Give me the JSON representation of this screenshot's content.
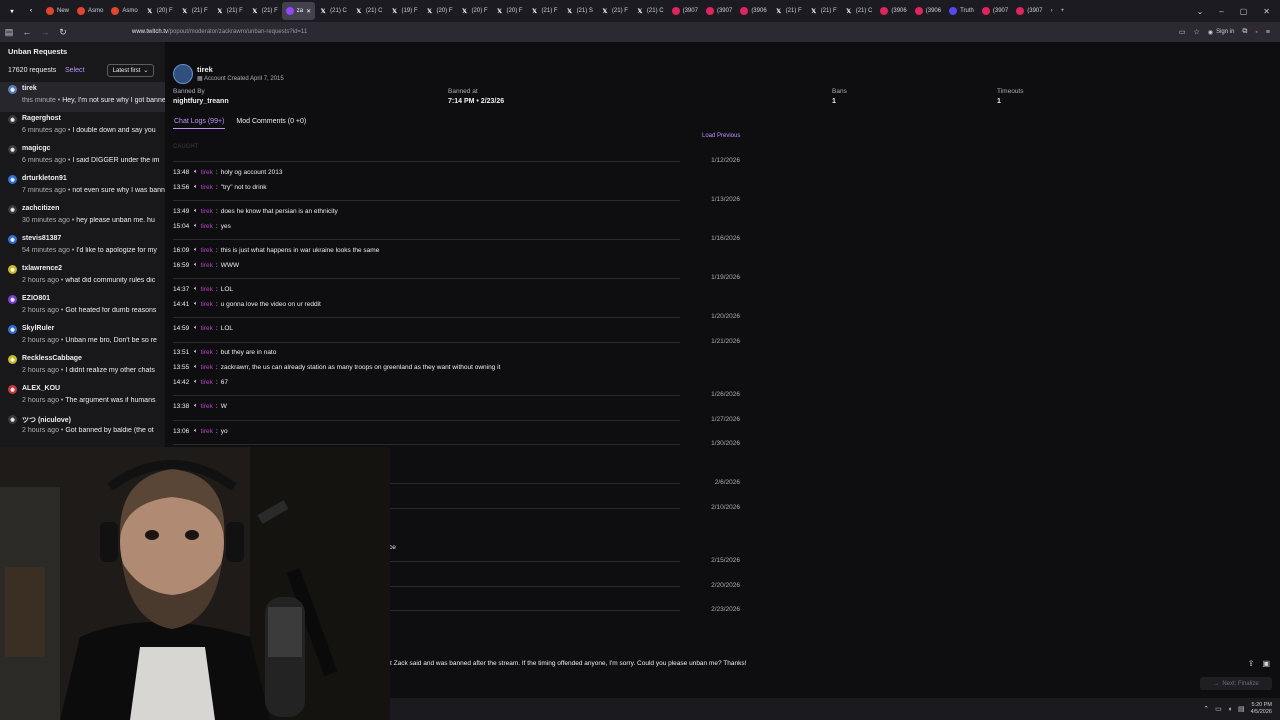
{
  "browser": {
    "tabs": [
      {
        "label": "",
        "icon": "tab-menu-icon"
      },
      {
        "label": "",
        "icon": "tab-back-list-icon"
      },
      {
        "label": "New",
        "icon": "new-tab-favicon"
      },
      {
        "label": "Asmo",
        "icon": "asmo-favicon"
      },
      {
        "label": "Asmo",
        "icon": "asmo-favicon"
      },
      {
        "label": "(20) F",
        "icon": "x-favicon"
      },
      {
        "label": "(21) F",
        "icon": "x-favicon"
      },
      {
        "label": "(21) F",
        "icon": "x-favicon"
      },
      {
        "label": "(21) F",
        "icon": "x-favicon"
      },
      {
        "label": "za",
        "icon": "twitch-favicon",
        "active": true
      },
      {
        "label": "(21) C",
        "icon": "x-favicon"
      },
      {
        "label": "(21) C",
        "icon": "x-favicon"
      },
      {
        "label": "(19) F",
        "icon": "x-favicon"
      },
      {
        "label": "(20) F",
        "icon": "x-favicon"
      },
      {
        "label": "(20) F",
        "icon": "x-favicon"
      },
      {
        "label": "(20) F",
        "icon": "x-favicon"
      },
      {
        "label": "(21) F",
        "icon": "x-favicon"
      },
      {
        "label": "(21) S",
        "icon": "x-favicon"
      },
      {
        "label": "(21) F",
        "icon": "x-favicon"
      },
      {
        "label": "(21) C",
        "icon": "x-favicon"
      },
      {
        "label": "(3907",
        "icon": "youtube-favicon"
      },
      {
        "label": "(3907",
        "icon": "youtube-favicon"
      },
      {
        "label": "(3906",
        "icon": "youtube-favicon"
      },
      {
        "label": "(21) F",
        "icon": "x-favicon"
      },
      {
        "label": "(21) F",
        "icon": "x-favicon"
      },
      {
        "label": "(21) C",
        "icon": "x-favicon"
      },
      {
        "label": "(3906",
        "icon": "youtube-favicon"
      },
      {
        "label": "(3906",
        "icon": "youtube-favicon"
      },
      {
        "label": "Truth",
        "icon": "truth-favicon"
      },
      {
        "label": "(3907",
        "icon": "youtube-favicon"
      },
      {
        "label": "(3907",
        "icon": "youtube-favicon"
      }
    ],
    "url_host": "www.twitch.tv",
    "url_path": "/popout/moderator/zackrawrn/unban-requests?id=11",
    "signin_label": "Sign in"
  },
  "sidebar": {
    "title": "Unban Requests",
    "count": "17620 requests",
    "select_label": "Select",
    "sort_label": "Latest first",
    "requests": [
      {
        "name": "tirek",
        "time": "this minute",
        "preview": "Hey, I'm not sure why I got banned",
        "color": "#5a7fb8",
        "active": true
      },
      {
        "name": "Ragerghost",
        "time": "6 minutes ago",
        "preview": "I double down and say you",
        "color": "#3a3a3f"
      },
      {
        "name": "magicgc",
        "time": "6 minutes ago",
        "preview": "I said DIGGER under the im",
        "color": "#3a3a3f"
      },
      {
        "name": "drturkleton91",
        "time": "7 minutes ago",
        "preview": "not even sure why I was banned",
        "color": "#2f6fd6"
      },
      {
        "name": "zachcitizen",
        "time": "30 minutes ago",
        "preview": "hey please unban me. hu",
        "color": "#3a3a3f"
      },
      {
        "name": "stevis81387",
        "time": "54 minutes ago",
        "preview": "I'd like to apologize for my",
        "color": "#2f6fd6"
      },
      {
        "name": "txlawrence2",
        "time": "2 hours ago",
        "preview": "what did community rules dic",
        "color": "#c9b91f"
      },
      {
        "name": "EZIO801",
        "time": "2 hours ago",
        "preview": "Got heated for dumb reasons",
        "color": "#7a3fd6"
      },
      {
        "name": "SkylRuler",
        "time": "2 hours ago",
        "preview": "Unban me bro, Don't be so re",
        "color": "#2f6fd6"
      },
      {
        "name": "RecklessCabbage",
        "time": "2 hours ago",
        "preview": "I didnt realize my other chats",
        "color": "#c9b91f"
      },
      {
        "name": "ALEX_KOU",
        "time": "2 hours ago",
        "preview": "The argument was if humans",
        "color": "#c23a3a"
      },
      {
        "name": "ツつ (niculove)",
        "time": "2 hours ago",
        "preview": "Got banned by baldie (the ot",
        "color": "#3a3a3f"
      }
    ]
  },
  "user": {
    "name": "tirek",
    "created": "Account Created April 7, 2015",
    "banned_by_label": "Banned By",
    "banned_by": "nightfury_treann",
    "banned_at_label": "Banned at",
    "banned_at": "7:14 PM • 2/23/26",
    "bans_label": "Bans",
    "bans": "1",
    "timeouts_label": "Timeouts",
    "timeouts": "1"
  },
  "tabs": {
    "chat_logs": "Chat Logs (99+)",
    "mod_comments": "Mod Comments (0 +0)"
  },
  "load_previous": "Load Previous",
  "faded_line": "CAUGHT",
  "logs": [
    {
      "ts": "13:48",
      "user": "tirek",
      "text": "holy og account 2013"
    },
    {
      "ts": "13:56",
      "user": "tirek",
      "text": "\"try\" not to drink"
    },
    {
      "ts": "13:49",
      "user": "tirek",
      "text": "does he know that persian is an ethnicity"
    },
    {
      "ts": "15:04",
      "user": "tirek",
      "text": "yes"
    },
    {
      "ts": "16:09",
      "user": "tirek",
      "text": "this is just what happens in war ukraine looks the same"
    },
    {
      "ts": "16:59",
      "user": "tirek",
      "text": "WWW"
    },
    {
      "ts": "14:37",
      "user": "tirek",
      "text": "LOL"
    },
    {
      "ts": "14:41",
      "user": "tirek",
      "text": "u gonna love the video on ur reddit"
    },
    {
      "ts": "14:59",
      "user": "tirek",
      "text": "LOL"
    },
    {
      "ts": "13:51",
      "user": "tirek",
      "text": "but they are in nato"
    },
    {
      "ts": "13:55",
      "user": "tirek",
      "text": "zackrawrr, the us can already station as many troops on greenland as they want without owning it"
    },
    {
      "ts": "14:42",
      "user": "tirek",
      "text": "67"
    },
    {
      "ts": "13:38",
      "user": "tirek",
      "text": "W"
    },
    {
      "ts": "13:06",
      "user": "tirek",
      "text": "yo"
    }
  ],
  "dates": [
    "1/12/2026",
    "1/13/2026",
    "1/16/2026",
    "1/19/2026",
    "1/20/2026",
    "1/21/2026",
    "1/26/2026",
    "1/27/2026",
    "1/30/2026",
    "2/6/2026",
    "2/10/2026",
    "2/15/2026",
    "2/20/2026",
    "2/23/2026"
  ],
  "partial_log_fragment": "ce",
  "request_message": "t Zack said and was banned after the stream. If the timing offended anyone, I'm sorry. Could you please unban me? Thanks!",
  "next_label": "Next: Finalize",
  "clock": {
    "time": "5:20 PM",
    "date": "4/5/2026"
  },
  "colors": {
    "accent": "#bf94ff",
    "username": "#bf3fc6",
    "background": "#0e0e10",
    "sidebar": "#18181b"
  }
}
